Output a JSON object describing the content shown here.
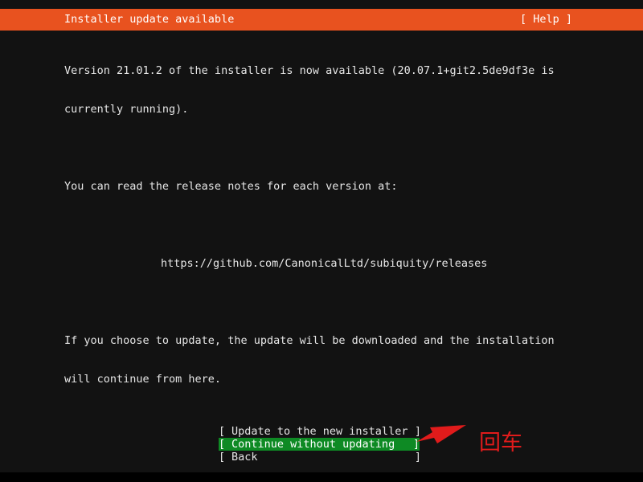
{
  "header": {
    "title": "Installer update available",
    "help_label": "[ Help ]",
    "background_color": "#e8521f",
    "text_color": "#ffffff"
  },
  "body": {
    "paragraph_1_line_1": "Version 21.01.2 of the installer is now available (20.07.1+git2.5de9df3e is",
    "paragraph_1_line_2": "currently running).",
    "paragraph_2_line_1": "You can read the release notes for each version at:",
    "url": "https://github.com/CanonicalLtd/subiquity/releases",
    "paragraph_3_line_1": "If you choose to update, the update will be downloaded and the installation",
    "paragraph_3_line_2": "will continue from here."
  },
  "menu": {
    "bracket_open": "[",
    "bracket_close": "]",
    "items": [
      {
        "label": "Update to the new installer",
        "selected": false
      },
      {
        "label": "Continue without updating",
        "selected": true
      },
      {
        "label": "Back",
        "selected": false
      }
    ],
    "selected_background_color": "#0e8a24",
    "selected_text_color": "#ffffff"
  },
  "annotation": {
    "text": "回车",
    "color": "#e01b1b",
    "arrow_name": "red-arrow-pointing-left"
  },
  "terminal": {
    "background_color": "#121212",
    "text_color": "#e6e6e6"
  }
}
